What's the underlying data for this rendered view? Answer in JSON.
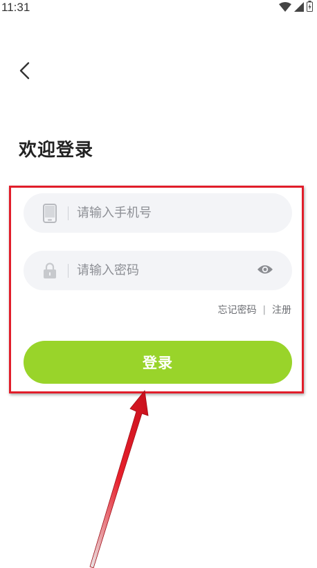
{
  "status_bar": {
    "time": "11:31",
    "icons": [
      "wifi-icon",
      "signal-icon",
      "battery-icon"
    ]
  },
  "nav": {
    "back_icon": "chevron-left-icon"
  },
  "page": {
    "title": "欢迎登录"
  },
  "form": {
    "phone": {
      "icon": "phone-icon",
      "placeholder": "请输入手机号",
      "value": ""
    },
    "password": {
      "icon": "lock-icon",
      "placeholder": "请输入密码",
      "value": "",
      "toggle_icon": "eye-icon"
    },
    "forgot_password": "忘记密码",
    "separator": "|",
    "register": "注册",
    "login_button": "登录"
  },
  "annotation": {
    "highlight_color": "#e11d2a"
  },
  "colors": {
    "accent": "#99d42a",
    "field_bg": "#f3f4f7"
  }
}
